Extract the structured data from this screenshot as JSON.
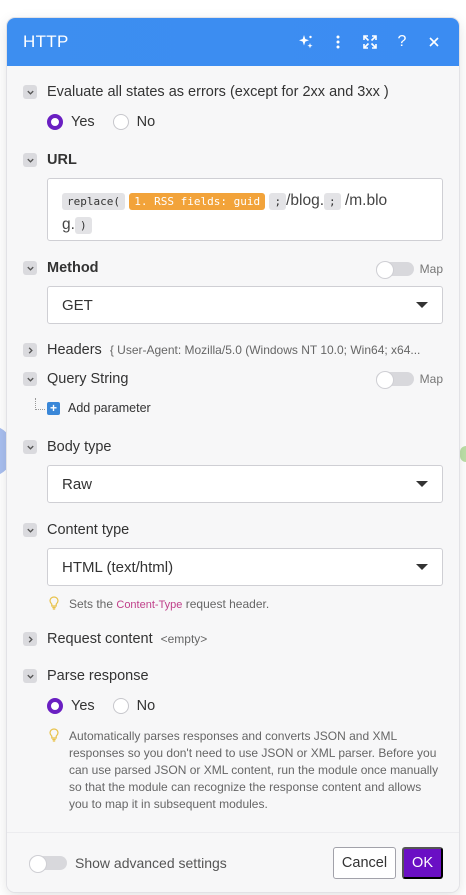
{
  "dialog": {
    "title": "HTTP",
    "header_icons": [
      "sparkle-icon",
      "more-vertical-icon",
      "expand-icon",
      "help-icon",
      "close-icon"
    ]
  },
  "evaluate": {
    "label": "Evaluate all states as errors (except for 2xx and 3xx )",
    "yes": "Yes",
    "no": "No",
    "selected": "Yes"
  },
  "url": {
    "label": "URL",
    "tokens": {
      "fn_open": "replace(",
      "var": "1. RSS fields: guid",
      "sep1": ";",
      "text1": "/blog.",
      "sep2": ";",
      "text2": "/m.blo",
      "text3": "g.",
      "fn_close": ")"
    }
  },
  "method": {
    "label": "Method",
    "map_label": "Map",
    "value": "GET"
  },
  "headers": {
    "label": "Headers",
    "summary": "{ User-Agent: Mozilla/5.0 (Windows NT 10.0; Win64; x64..."
  },
  "query_string": {
    "label": "Query String",
    "map_label": "Map",
    "add_param": "Add parameter"
  },
  "body_type": {
    "label": "Body type",
    "value": "Raw"
  },
  "content_type": {
    "label": "Content type",
    "value": "HTML (text/html)",
    "hint_prefix": "Sets the",
    "hint_code": "Content-Type",
    "hint_suffix": "request header."
  },
  "request_content": {
    "label": "Request content",
    "summary": "<empty>"
  },
  "parse_response": {
    "label": "Parse response",
    "yes": "Yes",
    "no": "No",
    "selected": "Yes",
    "hint": "Automatically parses responses and converts JSON and XML responses so you don't need to use JSON or XML parser. Before you can use parsed JSON or XML content, run the module once manually so that the module can recognize the response content and allows you to map it in subsequent modules."
  },
  "footer": {
    "advanced_label": "Show advanced settings",
    "cancel": "Cancel",
    "ok": "OK"
  },
  "colors": {
    "header": "#3d8ef0",
    "accent": "#6a0fc4",
    "pill_orange": "#f2a33a"
  }
}
